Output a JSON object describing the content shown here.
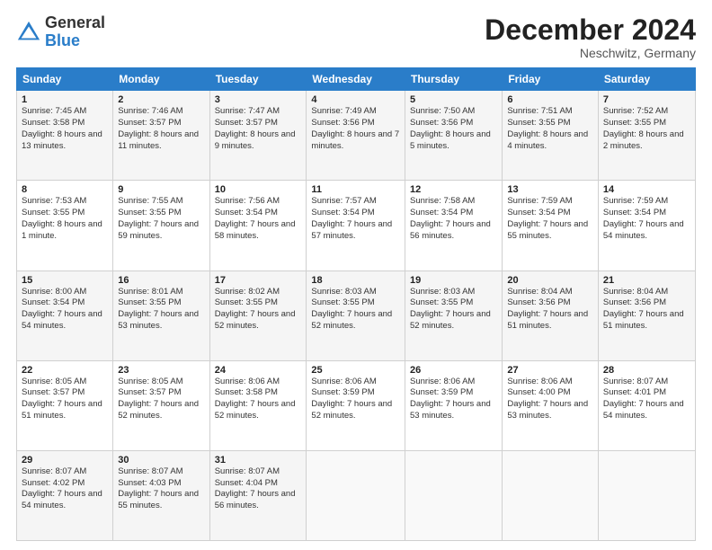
{
  "header": {
    "logo_general": "General",
    "logo_blue": "Blue",
    "month_title": "December 2024",
    "location": "Neschwitz, Germany"
  },
  "weekdays": [
    "Sunday",
    "Monday",
    "Tuesday",
    "Wednesday",
    "Thursday",
    "Friday",
    "Saturday"
  ],
  "weeks": [
    [
      {
        "day": "1",
        "sunrise": "7:45 AM",
        "sunset": "3:58 PM",
        "daylight": "8 hours and 13 minutes."
      },
      {
        "day": "2",
        "sunrise": "7:46 AM",
        "sunset": "3:57 PM",
        "daylight": "8 hours and 11 minutes."
      },
      {
        "day": "3",
        "sunrise": "7:47 AM",
        "sunset": "3:57 PM",
        "daylight": "8 hours and 9 minutes."
      },
      {
        "day": "4",
        "sunrise": "7:49 AM",
        "sunset": "3:56 PM",
        "daylight": "8 hours and 7 minutes."
      },
      {
        "day": "5",
        "sunrise": "7:50 AM",
        "sunset": "3:56 PM",
        "daylight": "8 hours and 5 minutes."
      },
      {
        "day": "6",
        "sunrise": "7:51 AM",
        "sunset": "3:55 PM",
        "daylight": "8 hours and 4 minutes."
      },
      {
        "day": "7",
        "sunrise": "7:52 AM",
        "sunset": "3:55 PM",
        "daylight": "8 hours and 2 minutes."
      }
    ],
    [
      {
        "day": "8",
        "sunrise": "7:53 AM",
        "sunset": "3:55 PM",
        "daylight": "8 hours and 1 minute."
      },
      {
        "day": "9",
        "sunrise": "7:55 AM",
        "sunset": "3:55 PM",
        "daylight": "7 hours and 59 minutes."
      },
      {
        "day": "10",
        "sunrise": "7:56 AM",
        "sunset": "3:54 PM",
        "daylight": "7 hours and 58 minutes."
      },
      {
        "day": "11",
        "sunrise": "7:57 AM",
        "sunset": "3:54 PM",
        "daylight": "7 hours and 57 minutes."
      },
      {
        "day": "12",
        "sunrise": "7:58 AM",
        "sunset": "3:54 PM",
        "daylight": "7 hours and 56 minutes."
      },
      {
        "day": "13",
        "sunrise": "7:59 AM",
        "sunset": "3:54 PM",
        "daylight": "7 hours and 55 minutes."
      },
      {
        "day": "14",
        "sunrise": "7:59 AM",
        "sunset": "3:54 PM",
        "daylight": "7 hours and 54 minutes."
      }
    ],
    [
      {
        "day": "15",
        "sunrise": "8:00 AM",
        "sunset": "3:54 PM",
        "daylight": "7 hours and 54 minutes."
      },
      {
        "day": "16",
        "sunrise": "8:01 AM",
        "sunset": "3:55 PM",
        "daylight": "7 hours and 53 minutes."
      },
      {
        "day": "17",
        "sunrise": "8:02 AM",
        "sunset": "3:55 PM",
        "daylight": "7 hours and 52 minutes."
      },
      {
        "day": "18",
        "sunrise": "8:03 AM",
        "sunset": "3:55 PM",
        "daylight": "7 hours and 52 minutes."
      },
      {
        "day": "19",
        "sunrise": "8:03 AM",
        "sunset": "3:55 PM",
        "daylight": "7 hours and 52 minutes."
      },
      {
        "day": "20",
        "sunrise": "8:04 AM",
        "sunset": "3:56 PM",
        "daylight": "7 hours and 51 minutes."
      },
      {
        "day": "21",
        "sunrise": "8:04 AM",
        "sunset": "3:56 PM",
        "daylight": "7 hours and 51 minutes."
      }
    ],
    [
      {
        "day": "22",
        "sunrise": "8:05 AM",
        "sunset": "3:57 PM",
        "daylight": "7 hours and 51 minutes."
      },
      {
        "day": "23",
        "sunrise": "8:05 AM",
        "sunset": "3:57 PM",
        "daylight": "7 hours and 52 minutes."
      },
      {
        "day": "24",
        "sunrise": "8:06 AM",
        "sunset": "3:58 PM",
        "daylight": "7 hours and 52 minutes."
      },
      {
        "day": "25",
        "sunrise": "8:06 AM",
        "sunset": "3:59 PM",
        "daylight": "7 hours and 52 minutes."
      },
      {
        "day": "26",
        "sunrise": "8:06 AM",
        "sunset": "3:59 PM",
        "daylight": "7 hours and 53 minutes."
      },
      {
        "day": "27",
        "sunrise": "8:06 AM",
        "sunset": "4:00 PM",
        "daylight": "7 hours and 53 minutes."
      },
      {
        "day": "28",
        "sunrise": "8:07 AM",
        "sunset": "4:01 PM",
        "daylight": "7 hours and 54 minutes."
      }
    ],
    [
      {
        "day": "29",
        "sunrise": "8:07 AM",
        "sunset": "4:02 PM",
        "daylight": "7 hours and 54 minutes."
      },
      {
        "day": "30",
        "sunrise": "8:07 AM",
        "sunset": "4:03 PM",
        "daylight": "7 hours and 55 minutes."
      },
      {
        "day": "31",
        "sunrise": "8:07 AM",
        "sunset": "4:04 PM",
        "daylight": "7 hours and 56 minutes."
      },
      null,
      null,
      null,
      null
    ]
  ]
}
